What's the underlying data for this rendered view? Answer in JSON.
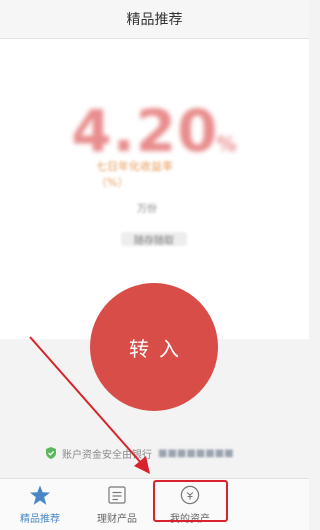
{
  "header": {
    "title": "精品推荐"
  },
  "product": {
    "rate_value": "4.20",
    "rate_unit": "%",
    "subtitle": "七日年化收益率（%）",
    "small_label": "万份",
    "tag": "随存随取"
  },
  "transfer_button": {
    "label": "转入"
  },
  "security": {
    "text": "账户资金安全由银行",
    "masked": "■■■■■■■■"
  },
  "tabbar": {
    "tabs": [
      {
        "label": "精品推荐",
        "icon": "star-icon",
        "active": true
      },
      {
        "label": "理财产品",
        "icon": "list-icon",
        "active": false
      },
      {
        "label": "我的资产",
        "icon": "wallet-icon",
        "active": false
      }
    ]
  },
  "colors": {
    "accent_red": "#d94d48",
    "tab_active": "#4a86c5",
    "annotation_red": "#d9232c",
    "security_green": "#5cb85c"
  }
}
